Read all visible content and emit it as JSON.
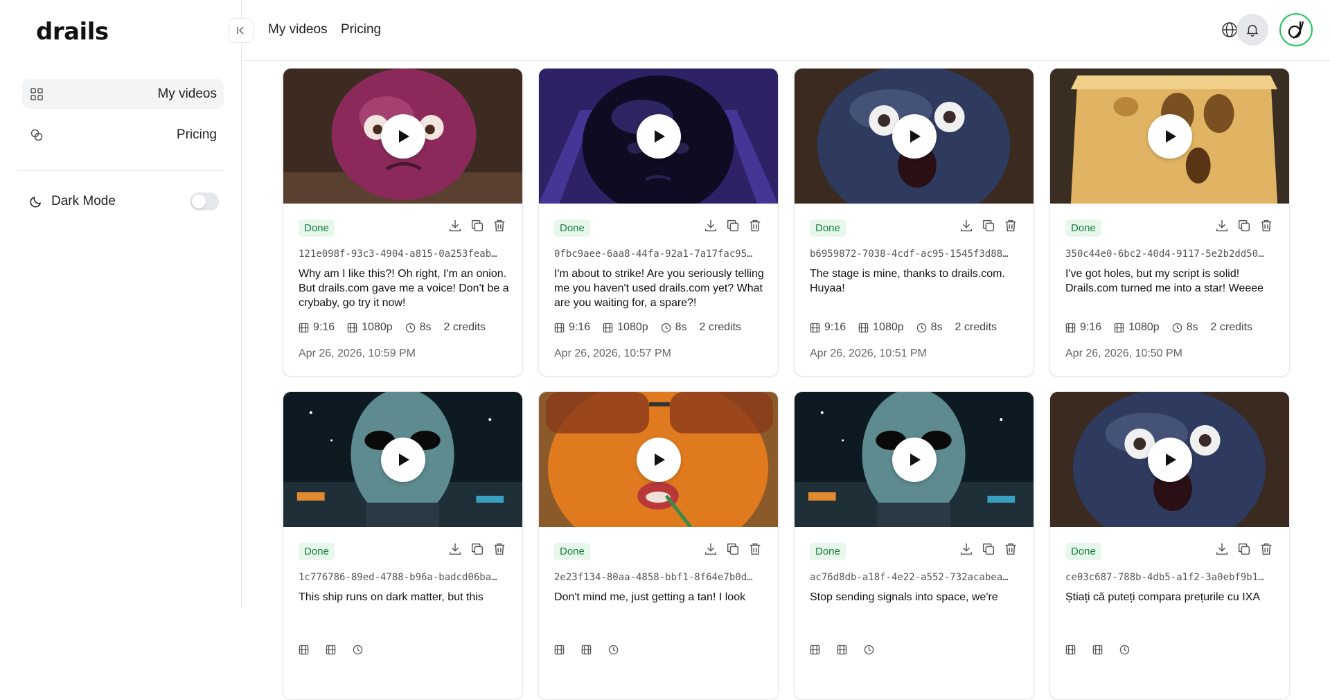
{
  "app": {
    "logo_text": "drails"
  },
  "sidebar": {
    "items": [
      {
        "label": "My videos",
        "icon": "grid-icon",
        "active": true
      },
      {
        "label": "Pricing",
        "icon": "coins-icon",
        "active": false
      }
    ],
    "dark_mode": {
      "label": "Dark Mode",
      "enabled": false
    }
  },
  "header": {
    "links": [
      "My videos",
      "Pricing"
    ],
    "icons": [
      "globe-icon",
      "bell-icon"
    ],
    "accent_color": "#22c55e"
  },
  "status_color": "#15803d",
  "cards": [
    {
      "status": "Done",
      "id": "121e098f-93c3-4904-a815-0a253feab…",
      "script": "Why am I like this?! Oh right, I'm an onion. But drails.com gave me a voice! Don't be a crybaby, go try it now!",
      "aspect": "9:16",
      "resolution": "1080p",
      "duration": "8s",
      "credits": "2 credits",
      "date": "Apr 26, 2026, 10:59 PM",
      "thumb": "onion"
    },
    {
      "status": "Done",
      "id": "0fbc9aee-6aa8-44fa-92a1-7a17fac95…",
      "script": "I'm about to strike! Are you seriously telling me you haven't used drails.com yet? What are you waiting for, a spare?!",
      "aspect": "9:16",
      "resolution": "1080p",
      "duration": "8s",
      "credits": "2 credits",
      "date": "Apr 26, 2026, 10:57 PM",
      "thumb": "bowling"
    },
    {
      "status": "Done",
      "id": "b6959872-7038-4cdf-ac95-1545f3d88…",
      "script": "The stage is mine, thanks to drails.com. Huyaa!",
      "aspect": "9:16",
      "resolution": "1080p",
      "duration": "8s",
      "credits": "2 credits",
      "date": "Apr 26, 2026, 10:51 PM",
      "thumb": "blueberry"
    },
    {
      "status": "Done",
      "id": "350c44e0-6bc2-40d4-9117-5e2b2dd50…",
      "script": "I've got holes, but my script is solid! Drails.com turned me into a star! Weeee",
      "aspect": "9:16",
      "resolution": "1080p",
      "duration": "8s",
      "credits": "2 credits",
      "date": "Apr 26, 2026, 10:50 PM",
      "thumb": "cheese"
    },
    {
      "status": "Done",
      "id": "1c776786-89ed-4788-b96a-badcd06ba…",
      "script": "This ship runs on dark matter, but this",
      "aspect": "",
      "resolution": "",
      "duration": "",
      "credits": "",
      "date": "",
      "thumb": "alien"
    },
    {
      "status": "Done",
      "id": "2e23f134-80aa-4858-bbf1-8f64e7b0d…",
      "script": "Don't mind me, just getting a tan! I look",
      "aspect": "",
      "resolution": "",
      "duration": "",
      "credits": "",
      "date": "",
      "thumb": "orange"
    },
    {
      "status": "Done",
      "id": "ac76d8db-a18f-4e22-a552-732acabea…",
      "script": "Stop sending signals into space, we're",
      "aspect": "",
      "resolution": "",
      "duration": "",
      "credits": "",
      "date": "",
      "thumb": "alien"
    },
    {
      "status": "Done",
      "id": "ce03c687-788b-4db5-a1f2-3a0ebf9b1…",
      "script": "Știați că puteți compara prețurile cu IXA",
      "aspect": "",
      "resolution": "",
      "duration": "",
      "credits": "",
      "date": "",
      "thumb": "blueberry"
    }
  ]
}
